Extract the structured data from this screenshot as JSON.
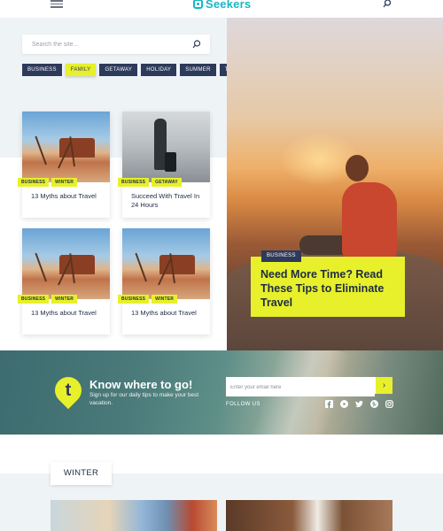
{
  "header": {
    "logo_text": "Seekers",
    "menu_icon": "hamburger-icon",
    "search_icon": "search-icon"
  },
  "search": {
    "placeholder": "Search the site..."
  },
  "tags": [
    {
      "label": "BUSINESS",
      "active": false
    },
    {
      "label": "FAMILY",
      "active": true
    },
    {
      "label": "GETAWAY",
      "active": false
    },
    {
      "label": "HOLIDAY",
      "active": false
    },
    {
      "label": "SUMMER",
      "active": false
    },
    {
      "label": "TRIP",
      "active": false
    }
  ],
  "cards": [
    {
      "tags": [
        "BUSINESS",
        "WINTER"
      ],
      "title": "13 Myths about Travel"
    },
    {
      "tags": [
        "BUSINESS",
        "GETAWAY"
      ],
      "title": "Succeed With Travel In 24 Hours"
    },
    {
      "tags": [
        "BUSINESS",
        "WINTER"
      ],
      "title": "13 Myths about Travel"
    },
    {
      "tags": [
        "BUSINESS",
        "WINTER"
      ],
      "title": "13 Myths about Travel"
    }
  ],
  "hero": {
    "tag": "BUSINESS",
    "title": "Need More Time? Read These Tips to Eliminate Travel"
  },
  "newsletter": {
    "badge_letter": "t",
    "title": "Know where to go!",
    "subtitle": "Sign up for our daily tips to make your best vacation.",
    "email_placeholder": "Enter your email here",
    "submit_icon": "chevron-right-icon",
    "follow_label": "FOLLOW US",
    "socials": [
      "facebook-icon",
      "youtube-icon",
      "twitter-icon",
      "pinterest-icon",
      "instagram-icon"
    ]
  },
  "section": {
    "label": "WINTER"
  },
  "colors": {
    "accent": "#e7f02a",
    "navy": "#2e3a59",
    "brand": "#14b8c6"
  }
}
